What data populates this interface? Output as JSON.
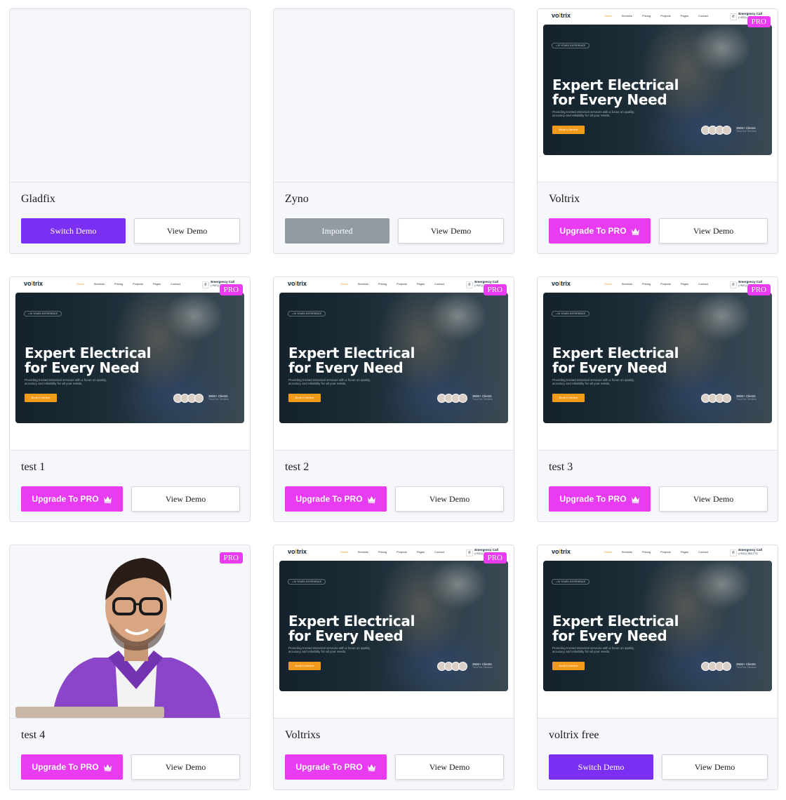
{
  "cards": [
    {
      "title": "Gladfix",
      "primary": "Switch Demo",
      "secondary": "View Demo",
      "kind": "blank"
    },
    {
      "title": "Zyno",
      "primary": "Imported",
      "secondary": "View Demo",
      "kind": "blank"
    },
    {
      "title": "Voltrix",
      "primary": "Upgrade To PRO",
      "secondary": "View Demo",
      "kind": "site",
      "badge": "PRO"
    },
    {
      "title": "test 1",
      "primary": "Upgrade To PRO",
      "secondary": "View Demo",
      "kind": "site",
      "badge": "PRO"
    },
    {
      "title": "test 2",
      "primary": "Upgrade To PRO",
      "secondary": "View Demo",
      "kind": "site",
      "badge": "PRO"
    },
    {
      "title": "test 3",
      "primary": "Upgrade To PRO",
      "secondary": "View Demo",
      "kind": "site",
      "badge": "PRO"
    },
    {
      "title": "test 4",
      "primary": "Upgrade To PRO",
      "secondary": "View Demo",
      "kind": "person",
      "badge": "PRO"
    },
    {
      "title": "Voltrixs",
      "primary": "Upgrade To PRO",
      "secondary": "View Demo",
      "kind": "site",
      "badge": "PRO"
    },
    {
      "title": "voltrix free",
      "primary": "Switch Demo",
      "secondary": "View Demo",
      "kind": "site"
    }
  ],
  "preview": {
    "logo_a": "vo",
    "logo_b": "l",
    "logo_c": "trix",
    "nav": [
      "Home",
      "Services",
      "Pricing",
      "Projects",
      "Pages",
      "Contact"
    ],
    "emergency_label": "Emergency Call",
    "emergency_phone": "(+021) 345 773",
    "pill": "• 20 YEARS EXPERIENCE",
    "headline_1": "Expert Electrical",
    "headline_2": "for Every Need",
    "subtext": "Providing trusted electrical services with a focus on quality, accuracy and reliability for all your needs.",
    "cta": "Book A Service",
    "clients": "3500+ Clients",
    "clients_sub": "Trust Our Services"
  },
  "colors": {
    "switch": "#7a2ff2",
    "imported": "#929aa2",
    "upgrade": "#e83bf2",
    "accent": "#f29a1a"
  },
  "icons": {
    "upgrade": "crown-icon"
  }
}
